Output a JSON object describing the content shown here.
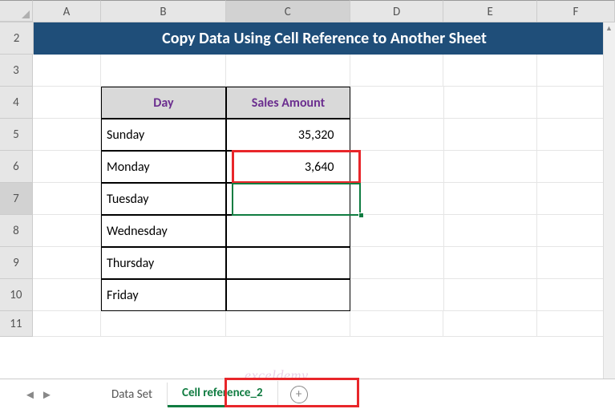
{
  "columns": [
    "A",
    "B",
    "C",
    "D",
    "E",
    "F"
  ],
  "rows": [
    "2",
    "3",
    "4",
    "5",
    "6",
    "7",
    "8",
    "9",
    "10",
    "11"
  ],
  "title": "Copy Data Using Cell Reference to Another Sheet",
  "table": {
    "headers": {
      "day": "Day",
      "amount": "Sales Amount"
    },
    "rows": [
      {
        "day": "Sunday",
        "amount": "35,320"
      },
      {
        "day": "Monday",
        "amount": "3,640"
      },
      {
        "day": "Tuesday",
        "amount": ""
      },
      {
        "day": "Wednesday",
        "amount": ""
      },
      {
        "day": "Thursday",
        "amount": ""
      },
      {
        "day": "Friday",
        "amount": ""
      }
    ]
  },
  "tabs": {
    "items": [
      "Data Set",
      "Cell reference_2"
    ],
    "active": "Cell reference_2",
    "add": "+"
  },
  "selected": {
    "col": "C",
    "row": "7"
  },
  "watermark": "exceldemy"
}
